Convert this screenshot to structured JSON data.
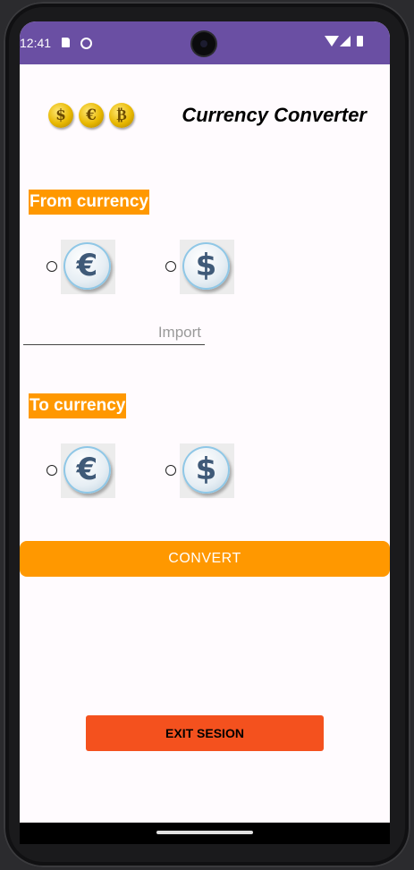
{
  "status_bar": {
    "time": "12:41",
    "icons": [
      "sd-card-icon",
      "sync-icon",
      "wifi-icon",
      "signal-icon",
      "battery-icon"
    ]
  },
  "header": {
    "logo_coins": [
      "$",
      "€",
      "₿"
    ],
    "title": "Currency Converter"
  },
  "from_section": {
    "label": "From currency",
    "options": [
      {
        "symbol": "€",
        "icon": "euro-icon",
        "selected": false
      },
      {
        "symbol": "$",
        "icon": "dollar-icon",
        "selected": false
      }
    ]
  },
  "amount_input": {
    "value": "",
    "placeholder": "Import"
  },
  "to_section": {
    "label": "To currency",
    "options": [
      {
        "symbol": "€",
        "icon": "euro-icon",
        "selected": false
      },
      {
        "symbol": "$",
        "icon": "dollar-icon",
        "selected": false
      }
    ]
  },
  "convert_button": {
    "label": "CONVERT"
  },
  "exit_button": {
    "label": "EXIT SESION"
  },
  "colors": {
    "status_bar": "#6a4fa3",
    "accent_orange": "#ff9800",
    "exit_red": "#f4511e",
    "background": "#fffbfe"
  }
}
